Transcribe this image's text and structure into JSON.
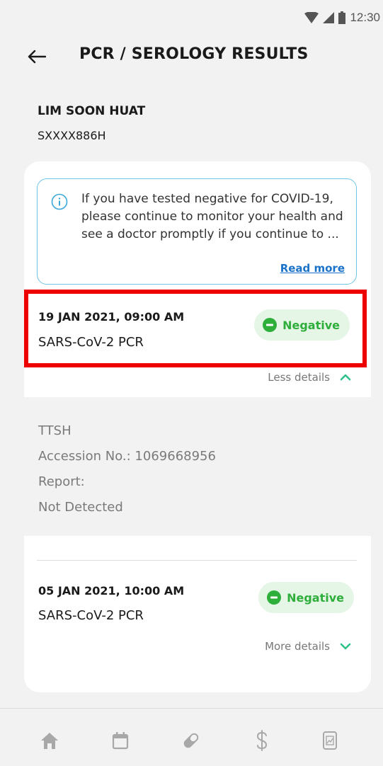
{
  "status_bar": {
    "time": "12:30"
  },
  "header": {
    "title": "PCR / SEROLOGY RESULTS"
  },
  "patient": {
    "name": "LIM SOON HUAT",
    "id": "SXXXX886H"
  },
  "info": {
    "message": "If you have tested negative for COVID-19, please continue to monitor your health and see a doctor promptly if you continue to ...",
    "read_more": "Read more"
  },
  "results": [
    {
      "datetime": "19 JAN 2021, 09:00 AM",
      "test": "SARS-CoV-2 PCR",
      "status": "Negative",
      "toggle": "Less details",
      "details": {
        "lab": "TTSH",
        "accession": "Accession No.: 1069668956",
        "report_label": "Report:",
        "report_value": "Not Detected"
      }
    },
    {
      "datetime": "05 JAN 2021, 10:00 AM",
      "test": "SARS-CoV-2 PCR",
      "status": "Negative",
      "toggle": "More details"
    }
  ],
  "colors": {
    "negative_text": "#2eae3a",
    "negative_bg": "#e5f5e6",
    "link": "#1a73c9",
    "info_border": "#6cc6e6",
    "highlight": "#ee0000",
    "chevron": "#2ec28a"
  },
  "bottom_nav": [
    {
      "icon": "home-icon"
    },
    {
      "icon": "calendar-icon"
    },
    {
      "icon": "pill-icon"
    },
    {
      "icon": "dollar-icon"
    },
    {
      "icon": "report-icon"
    }
  ]
}
